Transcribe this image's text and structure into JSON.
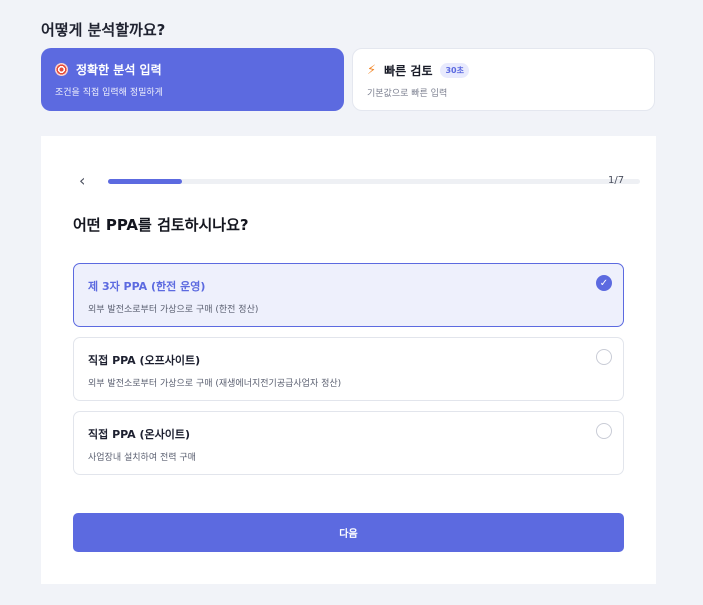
{
  "heading": "어떻게 분석할까요?",
  "modes": [
    {
      "title": "정확한 분석 입력",
      "subtitle": "조건을 직접 입력해 정밀하게",
      "icon": "target-icon"
    },
    {
      "title": "빠른 검토",
      "badge": "30초",
      "subtitle": "기본값으로 빠른 입력",
      "icon": "lightning-icon"
    }
  ],
  "wizard": {
    "step": "1/7",
    "progress": 0.14,
    "question": "어떤 PPA를 검토하시나요?",
    "options": [
      {
        "title": "제 3자 PPA (한전 운영)",
        "desc": "외부 발전소로부터 가상으로 구매 (한전 정산)",
        "selected": true
      },
      {
        "title": "직접 PPA (오프사이트)",
        "desc": "외부 발전소로부터 가상으로 구매 (재생에너지전기공급사업자 정산)",
        "selected": false
      },
      {
        "title": "직접 PPA (온사이트)",
        "desc": "사업장내 설치하여 전력 구매",
        "selected": false
      }
    ],
    "next_label": "다음"
  },
  "colors": {
    "accent": "#5c6ae0",
    "background": "#f1f3f8"
  }
}
